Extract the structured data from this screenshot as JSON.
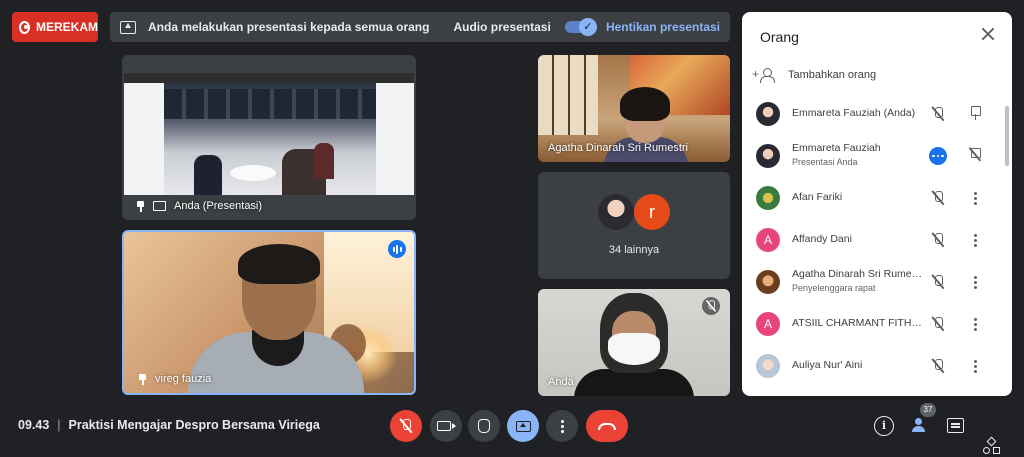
{
  "recording": {
    "label": "MEREKAM"
  },
  "presenting_bar": {
    "message": "Anda melakukan presentasi kepada semua orang",
    "audio_label": "Audio presentasi",
    "audio_enabled": true,
    "stop_label": "Hentikan presentasi"
  },
  "tiles": {
    "presentation": {
      "label": "Anda (Presentasi)"
    },
    "vireg": {
      "label": "vireg fauzia",
      "speaking": true
    },
    "agatha": {
      "label": "Agatha Dinarah Sri Rumestri"
    },
    "others": {
      "letter": "r",
      "count_label": "34 lainnya"
    },
    "anda": {
      "label": "Anda",
      "muted": true
    }
  },
  "people_panel": {
    "title": "Orang",
    "add_label": "Tambahkan orang",
    "participants": [
      {
        "name": "Emmareta Fauziah (Anda)",
        "subtitle": "",
        "avatar": "photo1",
        "mic_muted": true,
        "action": "pin"
      },
      {
        "name": "Emmareta Fauziah",
        "subtitle": "Presentasi Anda",
        "avatar": "photo1",
        "mic_muted": false,
        "action": "unpin"
      },
      {
        "name": "Afan Fariki",
        "subtitle": "",
        "avatar": "photo2",
        "mic_muted": true,
        "action": "more"
      },
      {
        "name": "Affandy Dani",
        "subtitle": "",
        "avatar_letter": "A",
        "mic_muted": true,
        "action": "more"
      },
      {
        "name": "Agatha Dinarah Sri Rumestri",
        "subtitle": "Penyelenggara rapat",
        "avatar": "photo3",
        "mic_muted": true,
        "action": "more"
      },
      {
        "name": "ATSIIL CHARMANT FITHRIA",
        "subtitle": "",
        "avatar_letter": "A",
        "mic_muted": true,
        "action": "more"
      },
      {
        "name": "Auliya Nur' Aini",
        "subtitle": "",
        "avatar": "photo4",
        "mic_muted": true,
        "action": "more"
      }
    ]
  },
  "bottom_bar": {
    "time": "09.43",
    "separator": "|",
    "meeting_title": "Praktisi Mengajar Despro Bersama Viriega",
    "people_count": "37",
    "info_glyph": "i"
  },
  "icons": [
    "record-icon",
    "present-screen-icon",
    "check-icon",
    "pin-icon",
    "mic-off-icon",
    "camera-icon",
    "raise-hand-icon",
    "present-now-icon",
    "more-options-icon",
    "end-call-icon",
    "info-icon",
    "people-icon",
    "chat-icon",
    "activities-icon",
    "close-icon",
    "add-person-icon"
  ],
  "colors": {
    "recording_red": "#d93025",
    "accent_blue": "#8ab4f8",
    "end_call_red": "#ea4335",
    "background": "#202124"
  }
}
